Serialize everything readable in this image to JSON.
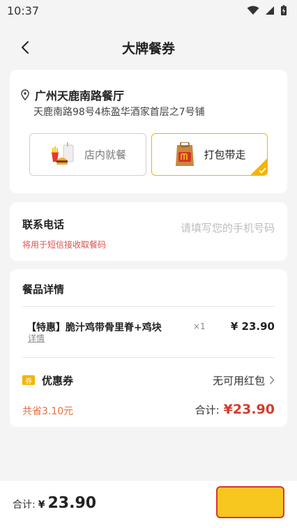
{
  "status_bar": {
    "time": "10:37"
  },
  "nav": {
    "title": "大牌餐券"
  },
  "store": {
    "name": "广州天鹿南路餐厅",
    "address": "天鹿南路98号4栋盈华酒家首层之7号铺"
  },
  "order_mode": {
    "dine_in_label": "店内就餐",
    "takeaway_label": "打包带走",
    "selected": "takeaway"
  },
  "contact": {
    "label": "联系电话",
    "placeholder": "请填写您的手机号码",
    "value": "",
    "hint": "将用于短信接收取餐码"
  },
  "items": {
    "title": "餐品详情",
    "list": [
      {
        "name": "【特惠】脆汁鸡带骨里脊+鸡块",
        "detail_label": "详情",
        "qty": "×1",
        "price": "¥ 23.90"
      }
    ],
    "coupon": {
      "badge": "券",
      "label": "优惠券",
      "value": "无可用红包"
    },
    "saved": "共省3.10元",
    "total_label": "合计:",
    "total": "¥23.90"
  },
  "footer": {
    "total_label": "合计:",
    "currency": "¥",
    "amount": "23.90"
  },
  "colors": {
    "accent_yellow": "#f5b400",
    "price_red": "#d43b2c",
    "hint_red": "#d9534f"
  }
}
